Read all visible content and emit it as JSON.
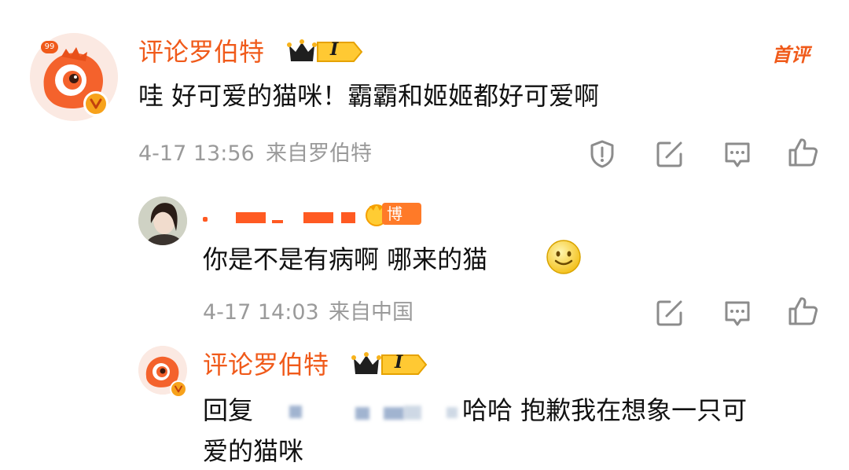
{
  "comment": {
    "username": "评论罗伯特",
    "level_badge": "I",
    "avatar_badge": "99",
    "tag": "首评",
    "text": "哇 好可爱的猫咪！霸霸和姬姬都好可爱啊",
    "time": "4-17 13:56",
    "source": "来自罗伯特"
  },
  "reply1": {
    "blogger_badge": "博主",
    "text": "你是不是有病啊 哪来的猫",
    "emoji": "smile-emoji",
    "time": "4-17 14:03",
    "source": "来自中国"
  },
  "reply2": {
    "username": "评论罗伯特",
    "level_badge": "I",
    "prefix": "回复",
    "text_line1": "哈哈 抱歉我在想象一只可",
    "text_line2": "爱的猫咪"
  },
  "icons": [
    "report-icon",
    "share-icon",
    "comment-icon",
    "like-icon"
  ],
  "colors": {
    "accent": "#f05a1a",
    "meta": "#9a9a9a",
    "icon": "#8c8c8c"
  }
}
